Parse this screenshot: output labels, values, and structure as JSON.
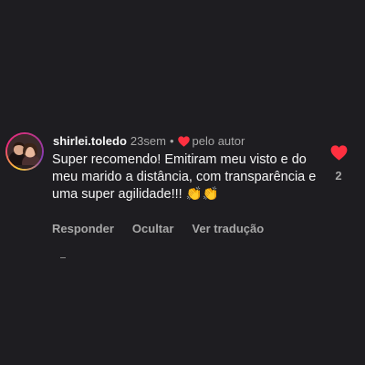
{
  "comment": {
    "username": "shirlei.toledo",
    "time": "23sem",
    "separator": "•",
    "author_like_label": "pelo autor",
    "text": "Super recomendo! Emitiram meu visto e do meu marido a distância, com transparência e uma super agilidade!!! 👏👏",
    "likes": "2",
    "actions": {
      "reply": "Responder",
      "hide": "Ocultar",
      "translate": "Ver tradução"
    }
  },
  "icons": {
    "author_heart": "heart-icon",
    "like": "heart-icon"
  },
  "colors": {
    "background": "#1e1d21",
    "heart": "#ff3040",
    "primary_text": "#f5f5f5",
    "secondary_text": "#a8a8a8"
  }
}
